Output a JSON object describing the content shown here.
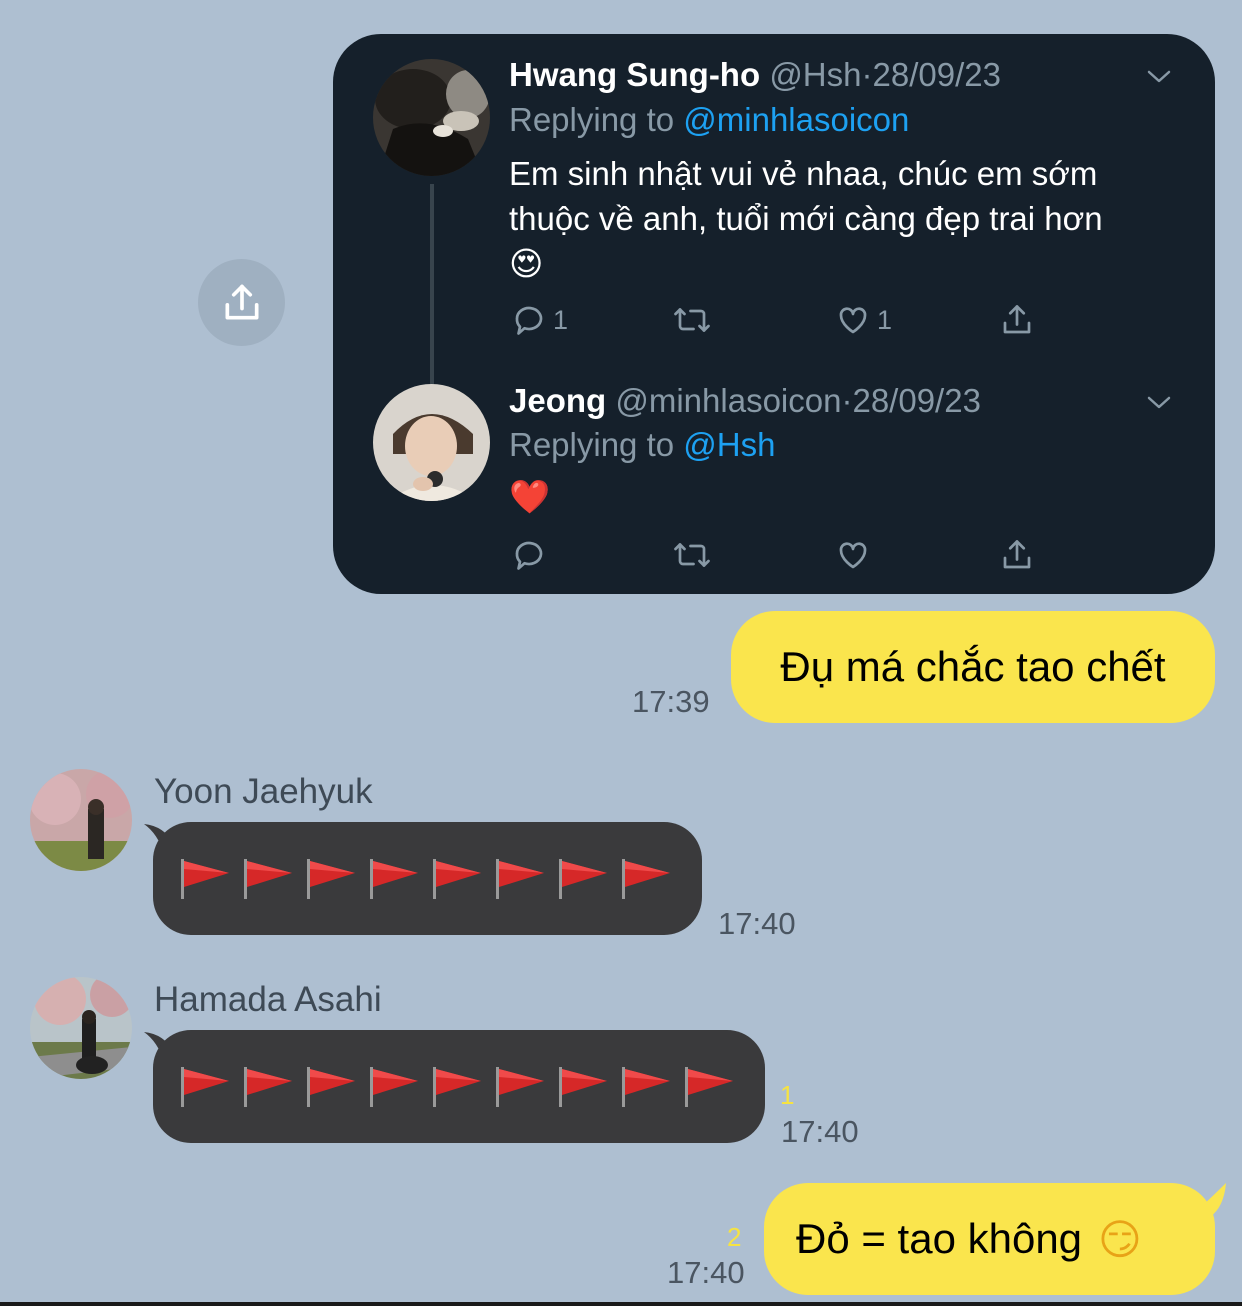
{
  "tweet_card": {
    "tweets": [
      {
        "name": "Hwang Sung-ho",
        "handle": "@Hsh",
        "date": "28/09/23",
        "replying_prefix": "Replying to ",
        "replying_to": "@minhlasoicon",
        "text": "Em sinh nhật vui vẻ nhaa, chúc em sớm thuộc về anh, tuổi mới càng đẹp trai hơn",
        "emoji": "😍",
        "reply_count": "1",
        "like_count": "1"
      },
      {
        "name": "Jeong",
        "handle": "@minhlasoicon",
        "date": "28/09/23",
        "replying_prefix": "Replying to ",
        "replying_to": "@Hsh",
        "emoji": "❤️",
        "reply_count": "",
        "like_count": ""
      }
    ],
    "separator": "·"
  },
  "messages": [
    {
      "sender": "me",
      "text": "Đụ má chắc tao chết",
      "time": "17:39"
    },
    {
      "sender": "Yoon Jaehyuk",
      "flag_count": 8,
      "time": "17:40"
    },
    {
      "sender": "Hamada Asahi",
      "flag_count": 9,
      "unread": "1",
      "time": "17:40"
    },
    {
      "sender": "me",
      "text": "Đỏ = tao không",
      "emoji": "😏",
      "unread": "2",
      "time": "17:40"
    }
  ],
  "icons": {
    "share": "share-icon",
    "flag": "triangular-flag-icon",
    "chevron": "chevron-down-icon"
  },
  "colors": {
    "background": "#aebfd1",
    "tweet_card": "#15202b",
    "my_bubble": "#fae54d",
    "their_bubble": "#3a3a3c",
    "link": "#1da1f2",
    "unread": "#f6e341"
  }
}
